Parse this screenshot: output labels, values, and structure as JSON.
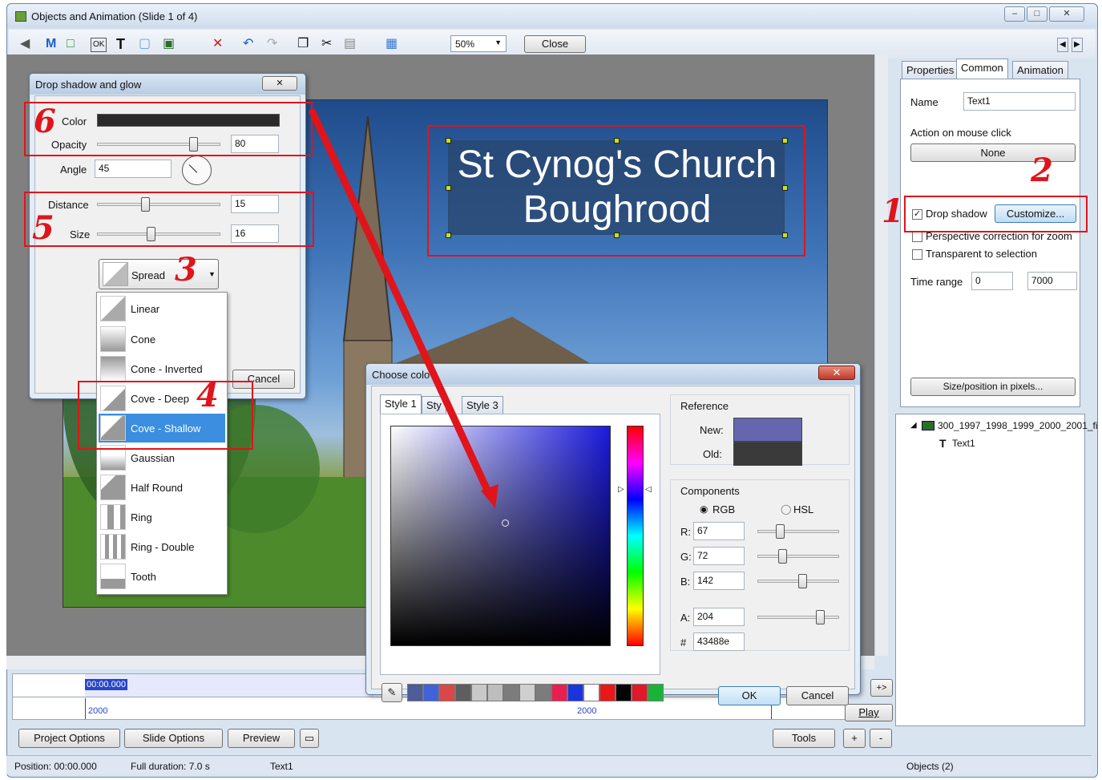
{
  "window": {
    "title": "Objects and Animation  (Slide 1 of 4)"
  },
  "toolbar": {
    "zoom": "50%",
    "close_label": "Close"
  },
  "slide": {
    "text_line1": "St Cynog's Church",
    "text_line2": "Boughrood"
  },
  "right_panel": {
    "tabs": [
      "Properties",
      "Common",
      "Animation"
    ],
    "active_tab": "Common",
    "name_label": "Name",
    "name_value": "Text1",
    "action_label": "Action on mouse click",
    "action_value": "None",
    "drop_shadow_label": "Drop shadow",
    "drop_shadow_checked": true,
    "customize_label": "Customize...",
    "perspective_label": "Perspective correction for zoom",
    "transparent_label": "Transparent to selection",
    "time_range_label": "Time range",
    "time_from": "0",
    "time_to": "7000",
    "size_position_label": "Size/position in pixels..."
  },
  "tree": {
    "image_item": "300_1997_1998_1999_2000_2001_fi",
    "text_item": "Text1"
  },
  "shadow_dialog": {
    "title": "Drop shadow and glow",
    "color_label": "Color",
    "color_value": "#2a2a2a",
    "opacity_label": "Opacity",
    "opacity_value": "80",
    "angle_label": "Angle",
    "angle_value": "45",
    "distance_label": "Distance",
    "distance_value": "15",
    "size_label": "Size",
    "size_value": "16",
    "spread_label": "Spread",
    "cancel_label": "Cancel"
  },
  "spread_menu": {
    "items": [
      "Linear",
      "Cone",
      "Cone - Inverted",
      "Cove - Deep",
      "Cove - Shallow",
      "Gaussian",
      "Half Round",
      "Ring",
      "Ring - Double",
      "Tooth"
    ],
    "selected": "Cove - Shallow"
  },
  "color_dialog": {
    "title": "Choose colo",
    "tabs": [
      "Style 1",
      "Sty",
      "Style 3"
    ],
    "reference_label": "Reference",
    "new_label": "New:",
    "old_label": "Old:",
    "components_label": "Components",
    "rgb_label": "RGB",
    "hsl_label": "HSL",
    "r_label": "R:",
    "r_value": "67",
    "g_label": "G:",
    "g_value": "72",
    "b_label": "B:",
    "b_value": "142",
    "a_label": "A:",
    "a_value": "204",
    "hash_label": "#",
    "hex_value": "43488e",
    "ok_label": "OK",
    "cancel_label": "Cancel",
    "palette": [
      "#4e5c9a",
      "#3f63d8",
      "#d94848",
      "#5e5e5e",
      "#c8c8c8",
      "#bdbdbd",
      "#7c7c7c",
      "#cfcfcf",
      "#7c7c7c",
      "#e8204f",
      "#1a34e0",
      "#ffffff",
      "#e81818",
      "#050505",
      "#e01828",
      "#18b43a"
    ]
  },
  "timeline": {
    "time_marker": "00:00.000",
    "tick_left": "2000",
    "tick_mid": "2000",
    "play_label": "Play",
    "plus_plus": "+>",
    "plus": "+",
    "minus": "-"
  },
  "bottom_buttons": {
    "project_options": "Project Options",
    "slide_options": "Slide Options",
    "preview": "Preview",
    "tools": "Tools"
  },
  "status": {
    "position": "Position: 00:00.000",
    "duration": "Full duration: 7.0 s",
    "object": "Text1",
    "objects_count": "Objects (2)"
  },
  "annotations": [
    "1",
    "2",
    "3",
    "4",
    "5",
    "6"
  ]
}
